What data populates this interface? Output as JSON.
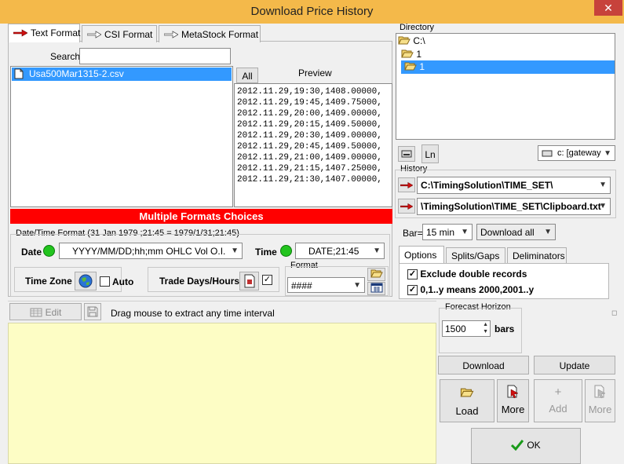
{
  "window": {
    "title": "Download Price History",
    "close_glyph": "✕"
  },
  "format_tabs": [
    {
      "label": "Text Format"
    },
    {
      "label": "CSI Format"
    },
    {
      "label": "MetaStock Format"
    }
  ],
  "search": {
    "label": "Search",
    "value": ""
  },
  "file_list": [
    {
      "name": "Usa500Mar1315-2.csv"
    }
  ],
  "preview": {
    "all_button": "All",
    "header": "Preview",
    "lines": [
      "2012.11.29,19:30,1408.00000,",
      "2012.11.29,19:45,1409.75000,",
      "2012.11.29,20:00,1409.00000,",
      "2012.11.29,20:15,1409.50000,",
      "2012.11.29,20:30,1409.00000,",
      "2012.11.29,20:45,1409.50000,",
      "2012.11.29,21:00,1409.00000,",
      "2012.11.29,21:15,1407.25000,",
      "2012.11.29,21:30,1407.00000,"
    ]
  },
  "banner": {
    "text": "Multiple Formats Choices",
    "color": "#ff0000"
  },
  "datetime": {
    "group_label": "Date/Time Format (31 Jan 1979 ;21:45 =  1979/1/31;21:45)",
    "date_label": "Date",
    "date_value": "YYYY/MM/DD;hh;mm  OHLC Vol O.I.",
    "time_label": "Time",
    "time_value": "DATE;21:45",
    "timezone_label": "Time Zone",
    "auto_label": "Auto",
    "trade_days_label": "Trade Days/Hours",
    "format_label": "Format",
    "format_value": "####"
  },
  "edit_toolbar": {
    "edit_label": "Edit",
    "hint": "Drag mouse to extract any time interval"
  },
  "directory": {
    "label": "Directory",
    "tree": [
      {
        "name": "C:\\"
      },
      {
        "name": "1"
      },
      {
        "name": "1"
      }
    ],
    "ln_button": "Ln",
    "drive_value": "c: [gateway"
  },
  "history": {
    "label": "History",
    "path1": "C:\\TimingSolution\\TIME_SET\\",
    "path2": "\\TimingSolution\\TIME_SET\\Clipboard.txt"
  },
  "bar": {
    "label": "Bar=",
    "value": "15 min",
    "download_mode": "Download all"
  },
  "options_tabs": [
    {
      "label": "Options"
    },
    {
      "label": "Splits/Gaps"
    },
    {
      "label": "Deliminators"
    }
  ],
  "options": {
    "exclude_label": "Exclude double records",
    "years_label": "0,1..y means 2000,2001..y"
  },
  "forecast": {
    "label": "Forecast Horizon",
    "value": "1500",
    "unit": "bars"
  },
  "actions": {
    "download": "Download",
    "update": "Update",
    "load": "Load",
    "more": "More",
    "add": "Add",
    "more2": "More",
    "ok": "OK"
  },
  "colors": {
    "titlebar": "#f4b94a",
    "selection": "#3399ff",
    "text_area": "#fdfdc5",
    "banner": "#ff0000"
  }
}
